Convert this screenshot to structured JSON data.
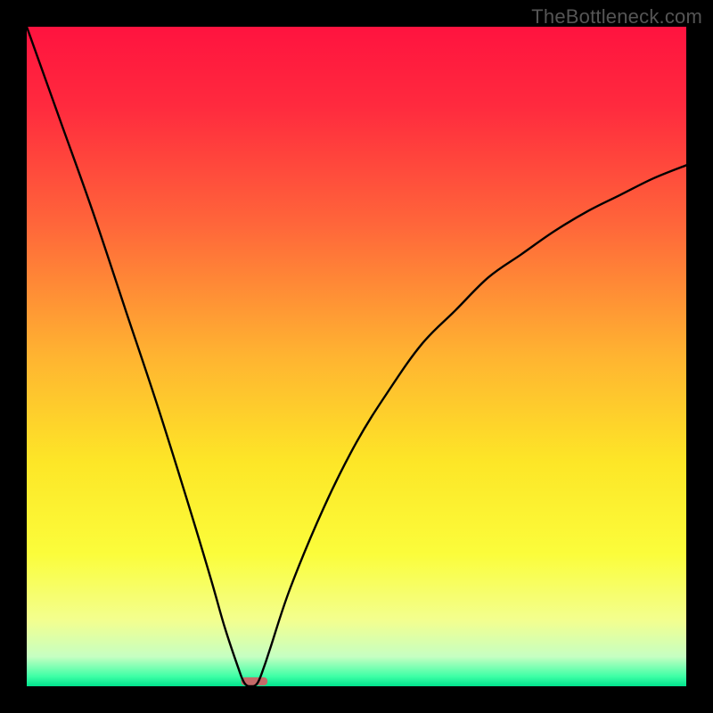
{
  "watermark": "TheBottleneck.com",
  "chart_data": {
    "type": "line",
    "title": "",
    "xlabel": "",
    "ylabel": "",
    "xlim": [
      0,
      100
    ],
    "ylim": [
      0,
      100
    ],
    "series": [
      {
        "name": "bottleneck-curve",
        "x": [
          0,
          5,
          10,
          15,
          20,
          25,
          28,
          30,
          32,
          33,
          34,
          35,
          36,
          37,
          40,
          45,
          50,
          55,
          60,
          65,
          70,
          75,
          80,
          85,
          90,
          95,
          100
        ],
        "values": [
          100,
          86,
          72,
          57,
          42,
          26,
          16,
          9,
          3,
          0.5,
          0,
          0.5,
          3,
          6,
          15,
          27,
          37,
          45,
          52,
          57,
          62,
          65.5,
          69,
          72,
          74.5,
          77,
          79
        ]
      }
    ],
    "annotations": [
      {
        "name": "floor-marker",
        "x_range": [
          32.5,
          36.5
        ],
        "y": 0,
        "color": "#c46a68"
      }
    ],
    "grid": false,
    "legend": false,
    "background_gradient": {
      "type": "vertical",
      "stops": [
        {
          "pos": 0.0,
          "color": "#ff133f"
        },
        {
          "pos": 0.12,
          "color": "#ff2a3e"
        },
        {
          "pos": 0.3,
          "color": "#ff663a"
        },
        {
          "pos": 0.5,
          "color": "#ffb431"
        },
        {
          "pos": 0.66,
          "color": "#fde627"
        },
        {
          "pos": 0.8,
          "color": "#fbfd3b"
        },
        {
          "pos": 0.9,
          "color": "#f3ff8f"
        },
        {
          "pos": 0.955,
          "color": "#c6ffc2"
        },
        {
          "pos": 0.985,
          "color": "#3effa6"
        },
        {
          "pos": 1.0,
          "color": "#00e38d"
        }
      ]
    }
  }
}
